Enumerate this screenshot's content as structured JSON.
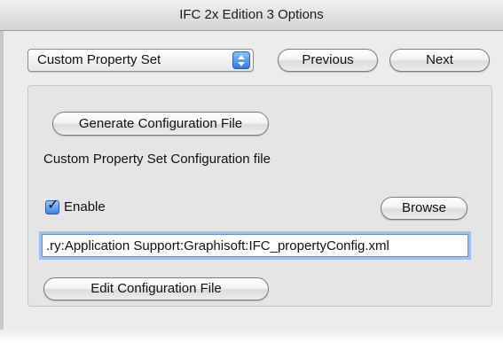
{
  "window": {
    "title": "IFC 2x Edition 3 Options"
  },
  "toolbar": {
    "property_set_selected": "Custom Property Set",
    "previous_label": "Previous",
    "next_label": "Next"
  },
  "panel": {
    "generate_label": "Generate Configuration File",
    "config_file_label": "Custom Property Set Configuration file",
    "enable_label": "Enable",
    "enable_checked": true,
    "browse_label": "Browse",
    "path_value": ".ry:Application Support:Graphisoft:IFC_propertyConfig.xml",
    "edit_label": "Edit Configuration File"
  },
  "icons": {
    "select_arrows": "up-down-arrows-icon",
    "checkbox_mark": "checkmark-icon"
  },
  "colors": {
    "accent_blue": "#3d83e6",
    "window_bg": "#ececec"
  }
}
